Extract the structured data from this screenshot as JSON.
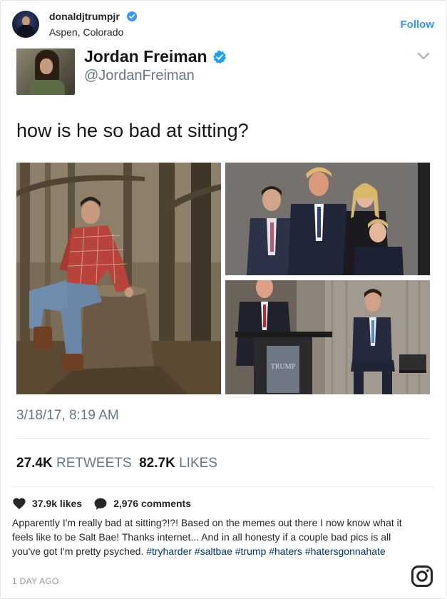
{
  "instagram": {
    "username": "donaldjtrumpjr",
    "location": "Aspen, Colorado",
    "follow_label": "Follow",
    "likes": "37.9k likes",
    "comments": "2,976 comments",
    "caption_text": "Apparently I'm really bad at sitting?!?! Based on the memes out there I now know what it feels like to be Salt Bae! Thanks internet... And in all honesty if a couple bad pics is all you've got I'm pretty psyched. ",
    "hashtags": [
      "#tryharder",
      "#saltbae",
      "#trump",
      "#haters",
      "#hatersgonnahate"
    ],
    "time_ago": "1 DAY AGO"
  },
  "tweet": {
    "name": "Jordan Freiman",
    "handle": "@JordanFreiman",
    "text": "how is he so bad at sitting?",
    "timestamp": "3/18/17, 8:19 AM",
    "retweets_count": "27.4K",
    "retweets_label": "RETWEETS",
    "likes_count": "82.7K",
    "likes_label": "LIKES",
    "podium_sign": "TRUMP"
  },
  "colors": {
    "verified_blue": "#3897f0",
    "twitter_verified": "#1da1f2",
    "hashtag": "#003569"
  }
}
